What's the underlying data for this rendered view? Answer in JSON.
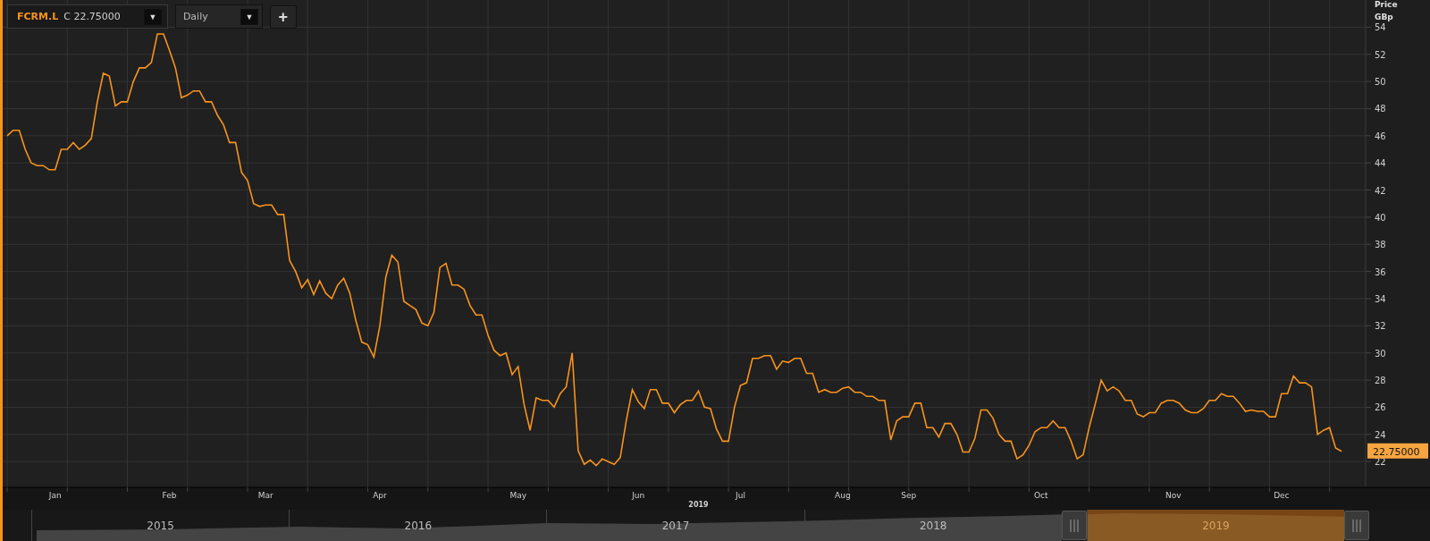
{
  "toolbar": {
    "close_label": "C 22.75000",
    "symbol_dropdown": "▼",
    "interval": "Daily",
    "interval_dropdown": "▼",
    "add_button": "+"
  },
  "price_axis": {
    "title": "Price",
    "unit": "GBp",
    "last_price": "22.75000"
  },
  "x_axis_year": "2019",
  "chart_data": {
    "type": "line",
    "categories": [
      null,
      null,
      null,
      null,
      null,
      null,
      null,
      null,
      "Jan",
      null,
      null,
      null,
      null,
      null,
      null,
      null,
      null,
      null,
      null,
      null,
      null,
      null,
      null,
      null,
      null,
      null,
      null,
      "Feb",
      null,
      null,
      null,
      null,
      null,
      null,
      null,
      null,
      null,
      null,
      null,
      null,
      null,
      null,
      null,
      "Mar",
      null,
      null,
      null,
      null,
      null,
      null,
      null,
      null,
      null,
      null,
      null,
      null,
      null,
      null,
      null,
      null,
      null,
      null,
      "Apr",
      null,
      null,
      null,
      null,
      null,
      null,
      null,
      null,
      null,
      null,
      null,
      null,
      null,
      null,
      null,
      null,
      null,
      null,
      null,
      null,
      null,
      null,
      "May",
      null,
      null,
      null,
      null,
      null,
      null,
      null,
      null,
      null,
      null,
      null,
      null,
      null,
      null,
      null,
      null,
      null,
      null,
      null,
      "Jun",
      null,
      null,
      null,
      null,
      null,
      null,
      null,
      null,
      null,
      null,
      null,
      null,
      null,
      null,
      null,
      null,
      "Jul",
      null,
      null,
      null,
      null,
      null,
      null,
      null,
      null,
      null,
      null,
      null,
      null,
      null,
      null,
      null,
      null,
      "Aug",
      null,
      null,
      null,
      null,
      null,
      null,
      null,
      null,
      null,
      null,
      "Sep",
      null,
      null,
      null,
      null,
      null,
      null,
      null,
      null,
      null,
      null,
      null,
      null,
      null,
      null,
      null,
      null,
      null,
      null,
      null,
      null,
      null,
      "Oct",
      null,
      null,
      null,
      null,
      null,
      null,
      null,
      null,
      null,
      null,
      null,
      null,
      null,
      null,
      null,
      null,
      null,
      null,
      null,
      null,
      null,
      "Nov",
      null,
      null,
      null,
      null,
      null,
      null,
      null,
      null,
      null,
      null,
      null,
      null,
      null,
      null,
      null,
      null,
      null,
      "Dec",
      null,
      null,
      null,
      null,
      null,
      null,
      null,
      null,
      null,
      null
    ],
    "series": [
      {
        "name": "FCRM.L",
        "color": "#f7931e",
        "values": [
          46,
          46.4,
          46.4,
          45,
          44,
          43.8,
          43.8,
          43.5,
          43.5,
          45,
          45,
          45.5,
          45,
          45.3,
          45.8,
          48.5,
          50.6,
          50.4,
          48.2,
          48.5,
          48.5,
          50,
          51,
          51,
          51.4,
          53.5,
          53.5,
          52.3,
          51,
          48.8,
          49,
          49.3,
          49.3,
          48.5,
          48.5,
          47.5,
          46.8,
          45.5,
          45.5,
          43.3,
          42.7,
          41,
          40.8,
          40.9,
          40.9,
          40.2,
          40.2,
          36.8,
          36,
          34.8,
          35.4,
          34.3,
          35.3,
          34.4,
          34,
          35,
          35.5,
          34.4,
          32.4,
          30.8,
          30.6,
          29.7,
          32,
          35.6,
          37.2,
          36.7,
          33.8,
          33.5,
          33.2,
          32.2,
          32,
          33,
          36.3,
          36.6,
          35,
          35,
          34.7,
          33.5,
          32.8,
          32.8,
          31.3,
          30.2,
          29.8,
          30,
          28.4,
          29,
          26.2,
          24.3,
          26.7,
          26.5,
          26.5,
          26,
          27,
          27.5,
          30,
          22.8,
          21.8,
          22.1,
          21.7,
          22.2,
          22,
          21.8,
          22.3,
          25,
          27.3,
          26.4,
          25.9,
          27.3,
          27.3,
          26.3,
          26.3,
          25.6,
          26.2,
          26.5,
          26.5,
          27.2,
          26,
          25.9,
          24.4,
          23.5,
          23.5,
          26,
          27.6,
          27.8,
          29.6,
          29.6,
          29.8,
          29.8,
          28.8,
          29.4,
          29.3,
          29.6,
          29.6,
          28.5,
          28.5,
          27.1,
          27.3,
          27.1,
          27.1,
          27.4,
          27.5,
          27.1,
          27.1,
          26.8,
          26.8,
          26.5,
          26.5,
          23.6,
          25,
          25.3,
          25.3,
          26.3,
          26.3,
          24.5,
          24.5,
          23.8,
          24.8,
          24.8,
          24,
          22.7,
          22.7,
          23.7,
          25.8,
          25.8,
          25.2,
          24,
          23.5,
          23.5,
          22.2,
          22.5,
          23.2,
          24.2,
          24.5,
          24.5,
          25,
          24.5,
          24.5,
          23.5,
          22.2,
          22.5,
          24.5,
          26.2,
          28,
          27.2,
          27.5,
          27.2,
          26.5,
          26.5,
          25.5,
          25.3,
          25.6,
          25.6,
          26.3,
          26.5,
          26.5,
          26.3,
          25.8,
          25.6,
          25.6,
          25.9,
          26.5,
          26.5,
          27,
          26.8,
          26.8,
          26.3,
          25.7,
          25.8,
          25.7,
          25.7,
          25.3,
          25.3,
          27,
          27,
          28.3,
          27.8,
          27.8,
          27.5,
          24,
          24.3,
          24.5,
          23,
          22.75
        ]
      }
    ],
    "ylim": [
      20.1,
      56
    ],
    "grid": true,
    "yticks": [
      22,
      24,
      26,
      28,
      30,
      32,
      34,
      36,
      38,
      40,
      42,
      44,
      46,
      48,
      50,
      52,
      54
    ]
  },
  "navigator": {
    "years": [
      {
        "label": "2015",
        "selected": false
      },
      {
        "label": "2016",
        "selected": false
      },
      {
        "label": "2017",
        "selected": false
      },
      {
        "label": "2018",
        "selected": false
      },
      {
        "label": "2019",
        "selected": true
      }
    ]
  }
}
